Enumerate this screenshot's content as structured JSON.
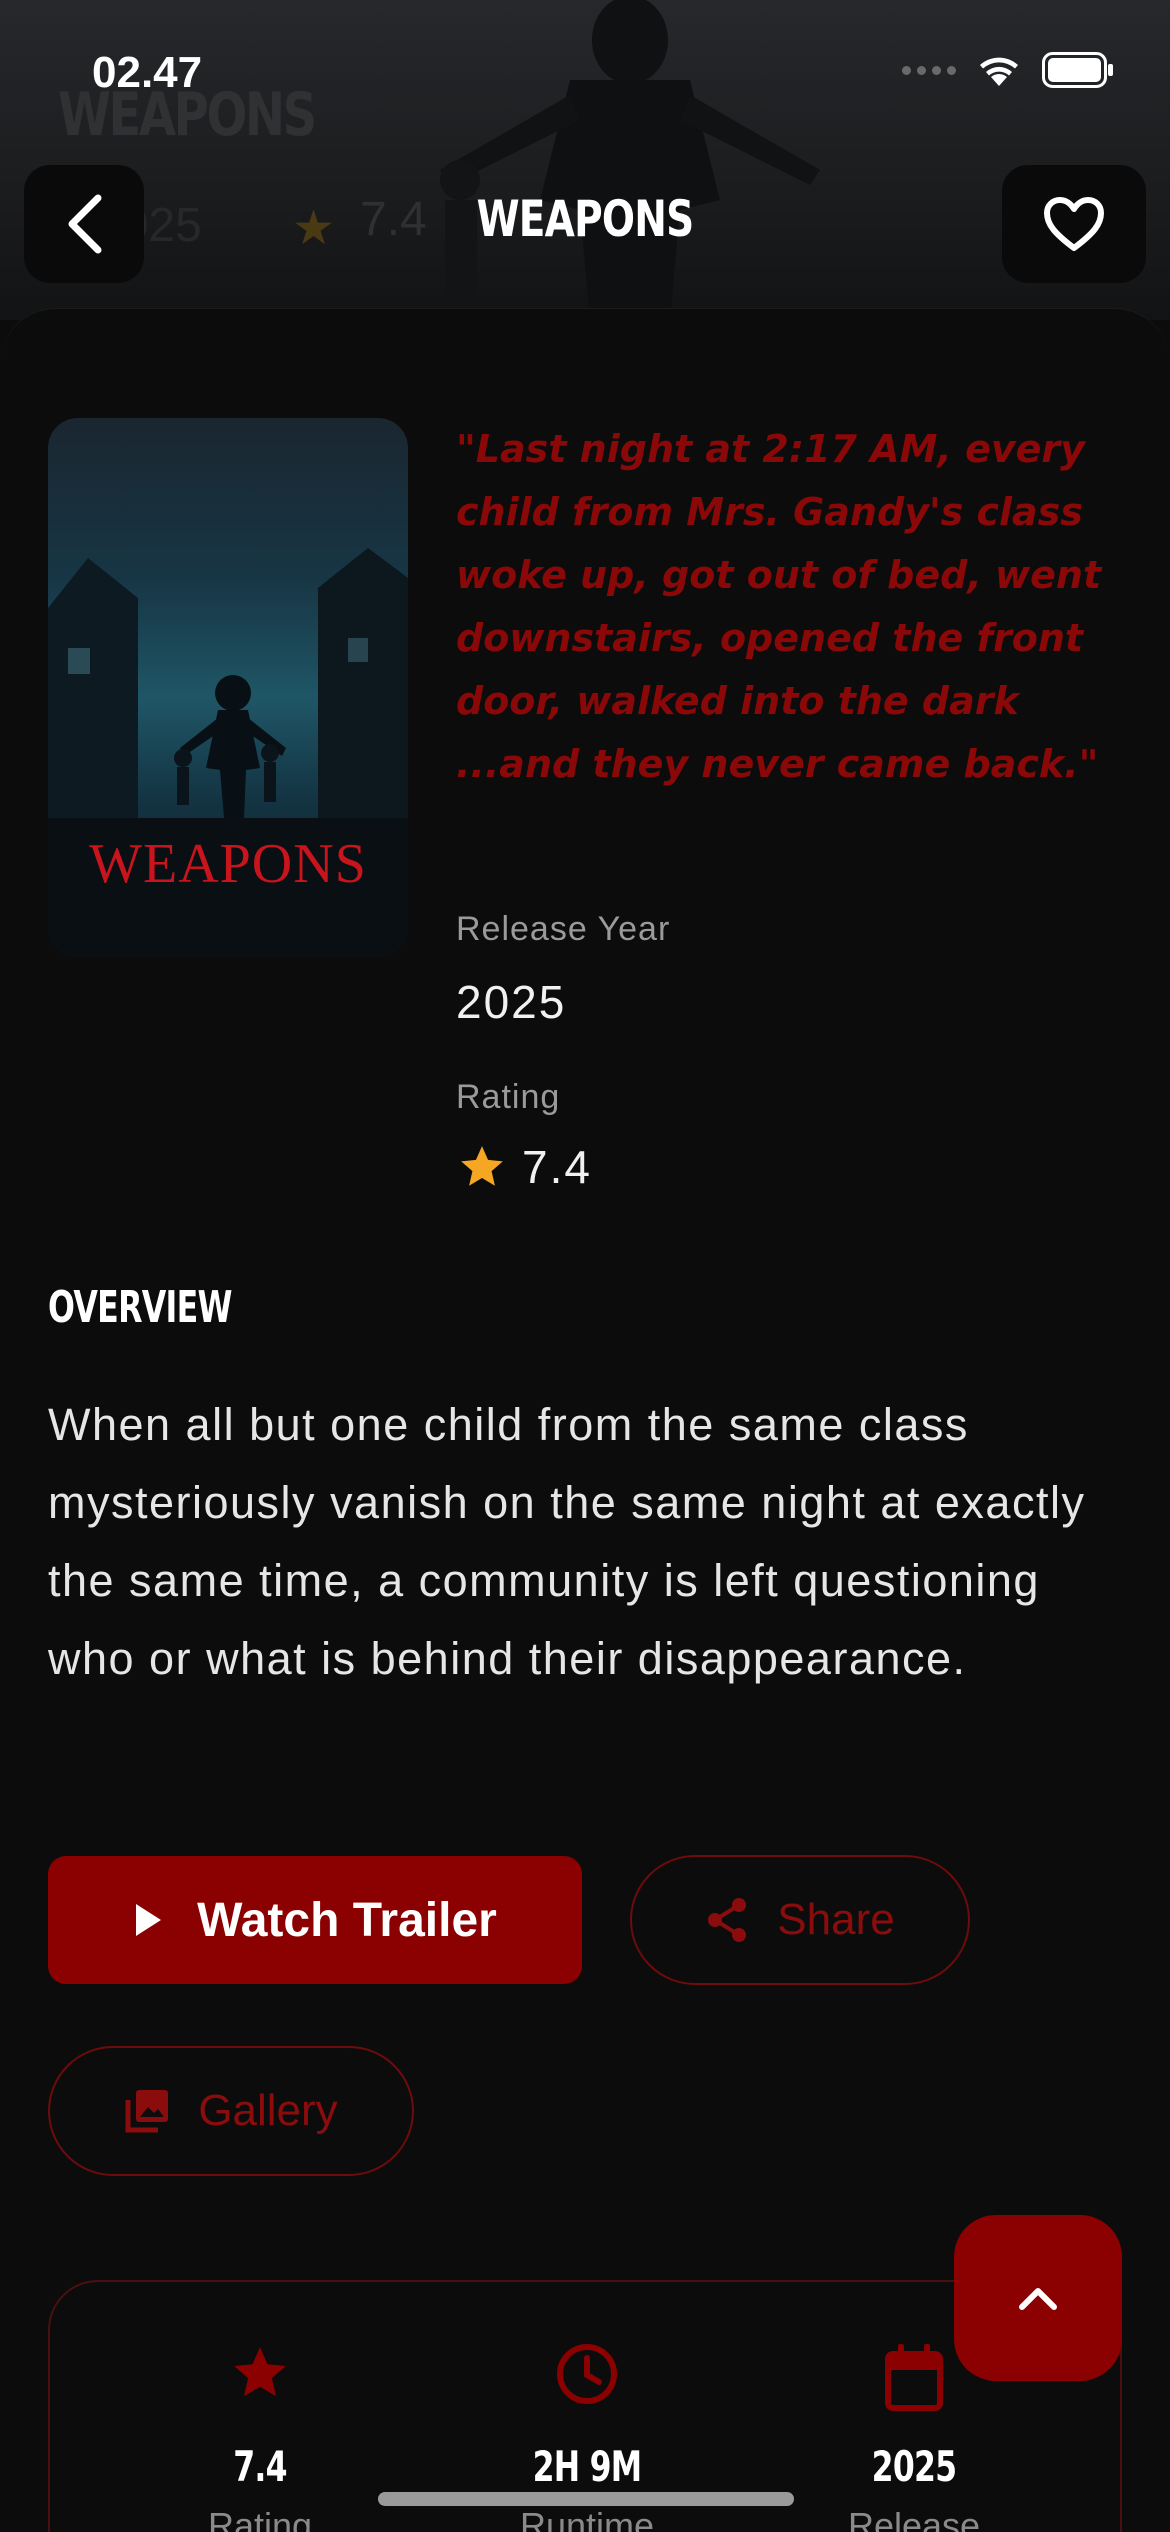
{
  "status_bar": {
    "time": "02.47"
  },
  "backdrop": {
    "title": "WEAPONS",
    "year": "2025",
    "rating": "7.4"
  },
  "nav": {
    "title": "WEAPONS"
  },
  "poster": {
    "title": "WEAPONS"
  },
  "tagline": "\"Last night at 2:17 AM, every child from Mrs. Gandy's class woke up, got out of bed, went downstairs, opened the front door, walked into the dark ...and they never came back.\"",
  "details": {
    "release_year_label": "Release Year",
    "release_year": "2025",
    "rating_label": "Rating",
    "rating": "7.4"
  },
  "overview": {
    "heading": "OVERVIEW",
    "text": "When all but one child from the same class mysteriously vanish on the same night at exactly the same time, a community is left questioning who or what is behind their disappearance."
  },
  "actions": {
    "watch_trailer": "Watch Trailer",
    "share": "Share",
    "gallery": "Gallery"
  },
  "stats": [
    {
      "value": "7.4",
      "label": "Rating",
      "icon": "star-icon"
    },
    {
      "value": "2H 9M",
      "label": "Runtime",
      "icon": "clock-icon"
    },
    {
      "value": "2025",
      "label": "Release",
      "icon": "calendar-icon"
    }
  ],
  "colors": {
    "accent": "#8b0000",
    "tagline": "#8a0808",
    "star": "#f5a623",
    "background": "#0c0c0d"
  }
}
